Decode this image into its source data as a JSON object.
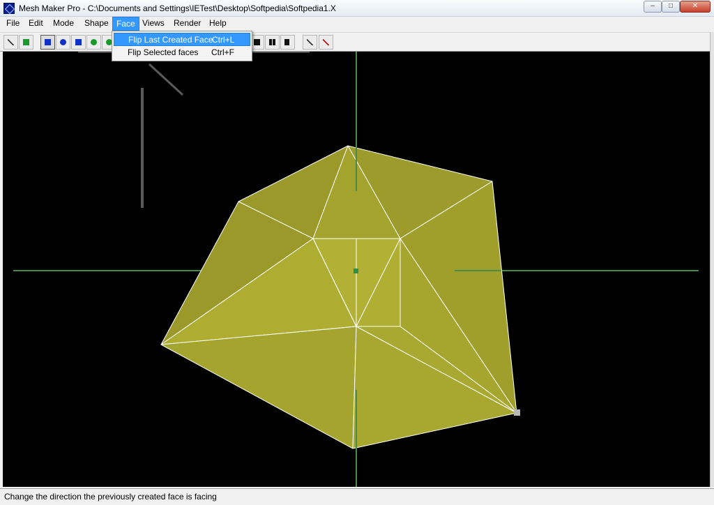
{
  "window": {
    "title": "Mesh Maker Pro -  C:\\Documents and Settings\\IETest\\Desktop\\Softpedia\\Softpedia1.X",
    "minimize_glyph": "–",
    "maximize_glyph": "□",
    "close_glyph": "✕"
  },
  "menubar": {
    "items": [
      {
        "label": "File"
      },
      {
        "label": "Edit"
      },
      {
        "label": "Mode"
      },
      {
        "label": "Shape"
      },
      {
        "label": "Face"
      },
      {
        "label": "Views"
      },
      {
        "label": "Render"
      },
      {
        "label": "Help"
      }
    ],
    "active": "Face"
  },
  "face_menu": {
    "items": [
      {
        "label": "Flip Last Created Face",
        "shortcut": "Ctrl+L",
        "highlighted": true
      },
      {
        "label": "Flip Selected faces",
        "shortcut": "Ctrl+F",
        "highlighted": false
      }
    ]
  },
  "toolbar": {
    "icons": [
      "draw-line-icon",
      "select-vertex-icon",
      "move-icon",
      "rotate-icon",
      "scale-icon",
      "move-axis-icon",
      "sphere-icon",
      "single-view-icon",
      "dual-view-icon",
      "quad-view-icon",
      "light-icon",
      "texture-icon"
    ]
  },
  "colors": {
    "mesh_fill": "#a6a52c",
    "mesh_edge": "#ffffff",
    "axis": "#4a8a4a",
    "viewport_bg": "#000000",
    "menu_highlight": "#3399ff"
  },
  "status": {
    "text": "Change the direction the previously created face is facing"
  }
}
